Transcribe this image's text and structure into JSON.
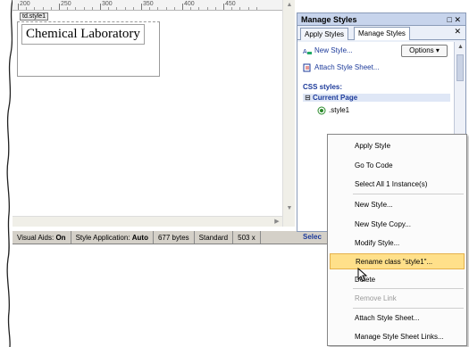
{
  "ruler": {
    "ticks": [
      "200",
      "250",
      "300",
      "350",
      "400",
      "450"
    ]
  },
  "editor": {
    "style_tag": "td.style1",
    "content_text": "Chemical Laboratory"
  },
  "status_bar": {
    "visual_aids_label": "Visual Aids:",
    "visual_aids_value": "On",
    "style_app_label": "Style Application:",
    "style_app_value": "Auto",
    "size": "677 bytes",
    "mode": "Standard",
    "resolution": "503 x"
  },
  "panel": {
    "title": "Manage Styles",
    "title_controls": "□ ✕",
    "tabs": [
      "Apply Styles",
      "Manage Styles"
    ],
    "tab_close": "✕",
    "new_style": "New Style...",
    "options": "Options ▾",
    "attach": "Attach Style Sheet...",
    "css_label": "CSS styles:",
    "group": "Current Page",
    "group_toggle": "⊟",
    "style_item": ".style1",
    "selected_label": "Selec"
  },
  "context_menu": {
    "items": [
      {
        "label": "Apply Style",
        "state": "normal"
      },
      {
        "label": "Go To Code",
        "state": "normal"
      },
      {
        "label": "Select All 1 Instance(s)",
        "state": "normal"
      },
      {
        "label": "New Style...",
        "state": "normal"
      },
      {
        "label": "New Style Copy...",
        "state": "normal"
      },
      {
        "label": "Modify Style...",
        "state": "normal"
      },
      {
        "label": "Rename class \"style1\"...",
        "state": "highlight"
      },
      {
        "label": "Delete",
        "state": "normal"
      },
      {
        "label": "Remove Link",
        "state": "disabled"
      },
      {
        "label": "Attach Style Sheet...",
        "state": "normal"
      },
      {
        "label": "Manage Style Sheet Links...",
        "state": "normal"
      }
    ]
  },
  "colors": {
    "panel_bg": "#eaeff8",
    "accent_blue": "#1c3a9a",
    "highlight": "#ffe08a"
  }
}
